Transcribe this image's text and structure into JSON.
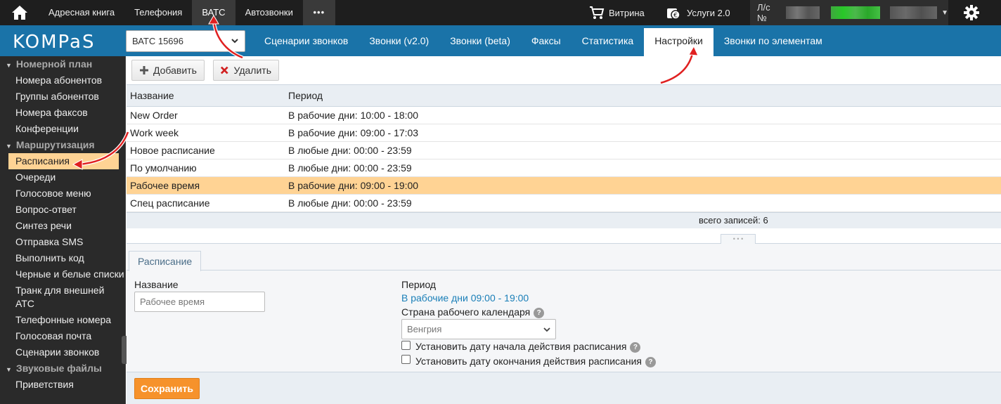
{
  "topbar": {
    "nav": [
      "Адресная книга",
      "Телефония",
      "ВАТС",
      "Автозвонки"
    ],
    "more": "•••",
    "shop": "Витрина",
    "services": "Услуги 2.0",
    "account_prefix": "Л/с №",
    "home_icon": "home-icon",
    "gear_icon": "gear-icon"
  },
  "header": {
    "logo": "KOMPaS",
    "vats_select": "ВАТС 15696",
    "tabs": [
      "Сценарии звонков",
      "Звонки (v2.0)",
      "Звонки (beta)",
      "Факсы",
      "Статистика",
      "Настройки",
      "Звонки по элементам"
    ],
    "active_tab": "Настройки"
  },
  "sidebar": {
    "groups": [
      {
        "title": "Номерной план",
        "items": [
          "Номера абонентов",
          "Группы абонентов",
          "Номера факсов",
          "Конференции"
        ]
      },
      {
        "title": "Маршрутизация",
        "items": [
          "Расписания",
          "Очереди",
          "Голосовое меню",
          "Вопрос-ответ",
          "Синтез речи",
          "Отправка SMS",
          "Выполнить код",
          "Черные и белые списки",
          "Транк для внешней АТС",
          "Телефонные номера",
          "Голосовая почта",
          "Сценарии звонков"
        ]
      },
      {
        "title": "Звуковые файлы",
        "items": [
          "Приветствия"
        ]
      }
    ],
    "selected": "Расписания"
  },
  "toolbar": {
    "add": "Добавить",
    "delete": "Удалить"
  },
  "table": {
    "columns": [
      "Название",
      "Период"
    ],
    "rows": [
      [
        "New Order",
        "В рабочие дни: 10:00 - 18:00"
      ],
      [
        "Work week",
        "В рабочие дни: 09:00 - 17:03"
      ],
      [
        "Новое расписание",
        "В любые дни: 00:00 - 23:59"
      ],
      [
        "По умолчанию",
        "В любые дни: 00:00 - 23:59"
      ],
      [
        "Рабочее время",
        "В рабочие дни: 09:00 - 19:00"
      ],
      [
        "Спец расписание",
        "В любые дни: 00:00 - 23:59"
      ]
    ],
    "selected_row": 4,
    "total": "всего записей: 6"
  },
  "form": {
    "tab": "Расписание",
    "name_label": "Название",
    "name_value": "Рабочее время",
    "period_label": "Период",
    "period_value": "В рабочие дни 09:00 - 19:00",
    "country_label": "Страна рабочего календаря",
    "country_value": "Венгрия",
    "start_date_label": "Установить дату начала действия расписания",
    "end_date_label": "Установить дату окончания действия расписания",
    "help": "?",
    "save": "Сохранить"
  },
  "colors": {
    "topbar": "#1e1e1e",
    "header": "#1a73a8",
    "sidebar": "#2a2a2a",
    "selected": "#ffd394",
    "save": "#f6922b",
    "link": "#1a73a8",
    "annotation_arrow": "#e02020"
  }
}
